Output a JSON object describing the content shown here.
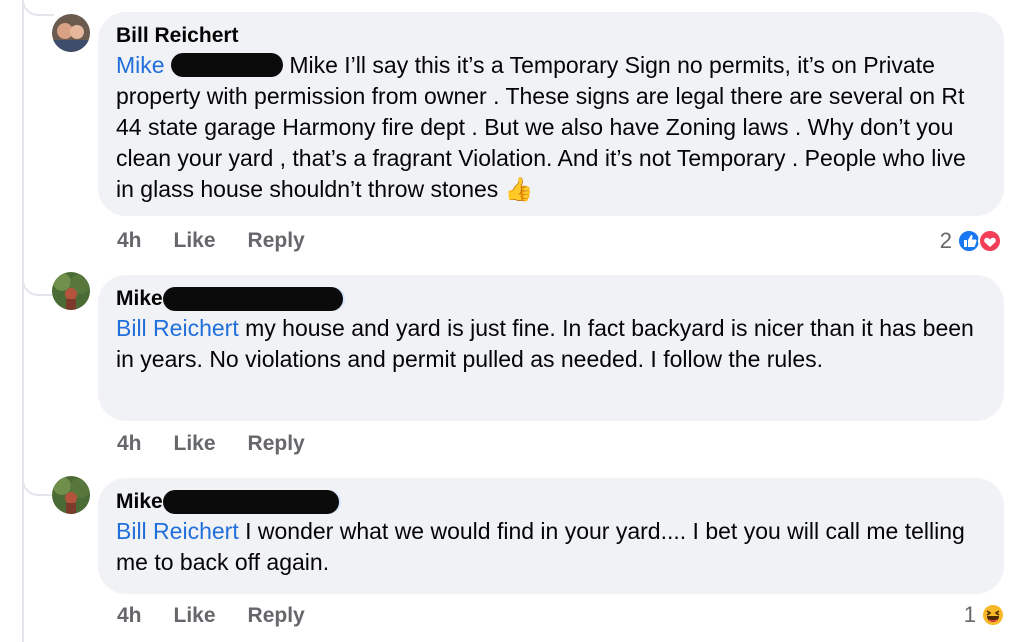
{
  "comments": [
    {
      "author": "Bill Reichert",
      "mention": "Mike",
      "text": "Mike I’ll say this it’s a Temporary Sign no permits, it’s on Private property with permission from owner . These signs are legal there are several on Rt 44 state garage Harmony fire dept . But we also have Zoning laws . Why don’t you clean your yard , that’s a fragrant Violation. And it’s not Temporary . People who live in glass house shouldn’t throw stones",
      "emoji": "👍",
      "time": "4h",
      "like": "Like",
      "reply": "Reply",
      "reaction_count": "2"
    },
    {
      "author": "Mike",
      "mention": "Bill Reichert",
      "text": "my house and yard is just fine.  In fact backyard is nicer than it has been in years.  No violations and permit pulled as needed.  I follow the rules.",
      "time": "4h",
      "like": "Like",
      "reply": "Reply"
    },
    {
      "author": "Mike",
      "mention": "Bill Reichert",
      "text": "I wonder what we would find in your yard.... I bet you will call me telling me to back off again.",
      "time": "4h",
      "like": "Like",
      "reply": "Reply",
      "reaction_count": "1"
    }
  ],
  "colors": {
    "mention": "#216fdb",
    "bubble": "#f0f2f5",
    "like_blue": "#1877f2",
    "love_red": "#f33e58",
    "haha_yellow": "#f7b928"
  },
  "icons": [
    "like-reaction-icon",
    "love-reaction-icon",
    "haha-reaction-icon",
    "thumbs-up-emoji"
  ]
}
